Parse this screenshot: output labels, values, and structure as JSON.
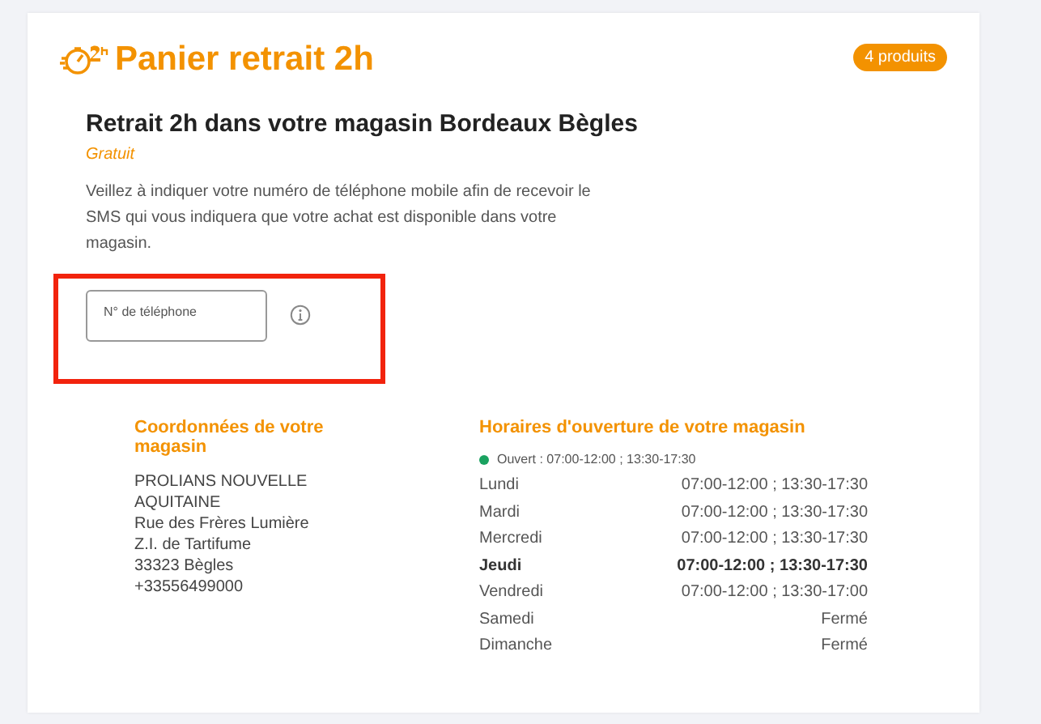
{
  "header": {
    "title": "Panier retrait 2h",
    "badge": "4 produits"
  },
  "pickup": {
    "heading": "Retrait 2h dans votre magasin Bordeaux Bègles",
    "price": "Gratuit",
    "notice": "Veillez à indiquer votre numéro de téléphone mobile afin de recevoir le SMS qui vous indiquera que votre achat est disponible dans votre magasin.",
    "phone_field": {
      "placeholder": "N° de téléphone",
      "highlighted": true
    }
  },
  "store": {
    "heading": "Coordonnées de votre magasin",
    "address": [
      "PROLIANS NOUVELLE AQUITAINE",
      "Rue des Frères Lumière",
      "Z.I. de Tartifume",
      "33323 Bègles",
      "+33556499000"
    ]
  },
  "hours": {
    "heading": "Horaires d'ouverture de votre magasin",
    "status": {
      "text": "Ouvert : 07:00-12:00 ; 13:30-17:30",
      "color": "#1aa260"
    },
    "days": [
      {
        "day": "Lundi",
        "time": "07:00-12:00 ; 13:30-17:30",
        "current": false
      },
      {
        "day": "Mardi",
        "time": "07:00-12:00 ; 13:30-17:30",
        "current": false
      },
      {
        "day": "Mercredi",
        "time": "07:00-12:00 ; 13:30-17:30",
        "current": false
      },
      {
        "day": "Jeudi",
        "time": "07:00-12:00 ; 13:30-17:30",
        "current": true
      },
      {
        "day": "Vendredi",
        "time": "07:00-12:00 ; 13:30-17:00",
        "current": false
      },
      {
        "day": "Samedi",
        "time": "Fermé",
        "current": false
      },
      {
        "day": "Dimanche",
        "time": "Fermé",
        "current": false
      }
    ]
  }
}
